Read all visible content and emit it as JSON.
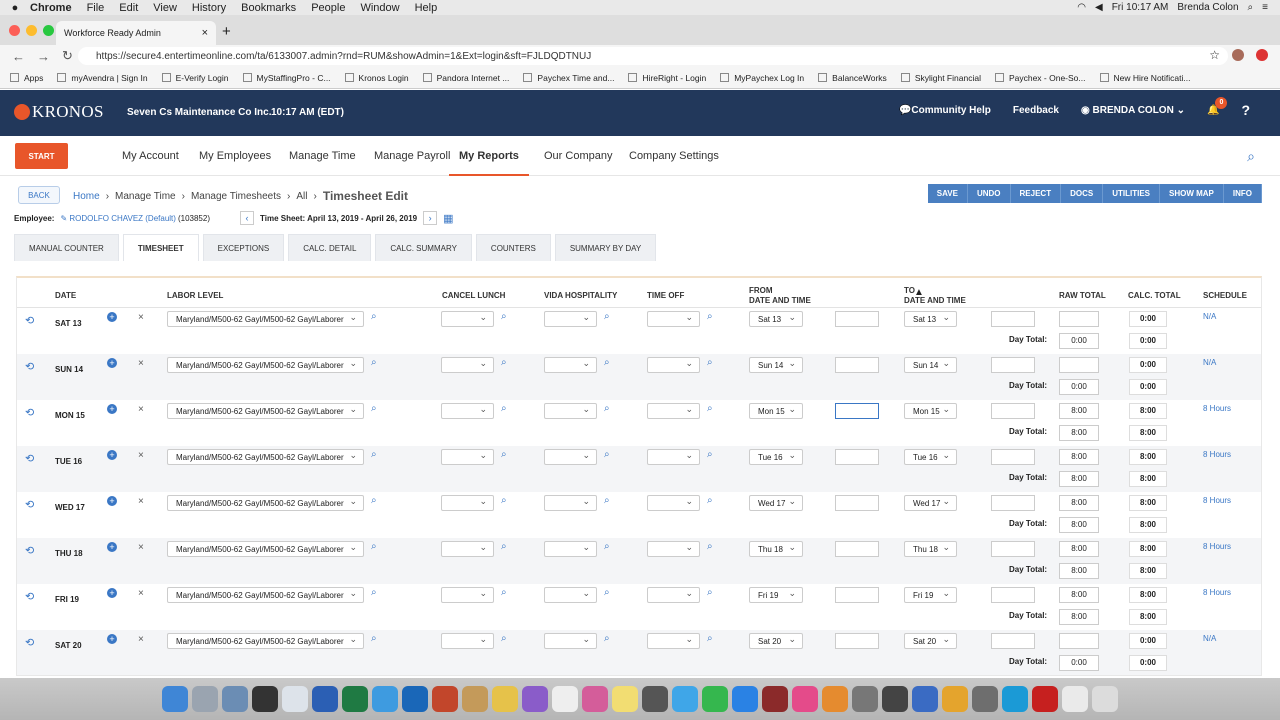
{
  "macmenu": {
    "app": "Chrome",
    "items": [
      "File",
      "Edit",
      "View",
      "History",
      "Bookmarks",
      "People",
      "Window",
      "Help"
    ],
    "clock": "Fri 10:17 AM",
    "user": "Brenda Colon"
  },
  "browser": {
    "tab_title": "Workforce Ready Admin",
    "url": "https://secure4.entertimeonline.com/ta/6133007.admin?rnd=RUM&showAdmin=1&Ext=login&sft=FJLDQDTNUJ",
    "bookmarks": [
      "Apps",
      "myAvendra | Sign In",
      "E-Verify Login",
      "MyStaffingPro - C...",
      "Kronos Login",
      "Pandora Internet ...",
      "Paychex Time and...",
      "HireRight - Login",
      "MyPaychex Log In",
      "BalanceWorks",
      "Skylight Financial",
      "Paychex - One-So...",
      "New Hire Notificati..."
    ]
  },
  "header": {
    "logo": "KRONOS",
    "company": "Seven Cs Maintenance Co Inc.",
    "time": "10:17 AM (EDT)",
    "help": "Community Help",
    "feedback": "Feedback",
    "user": "BRENDA COLON",
    "notif": "0"
  },
  "nav": {
    "start": "START",
    "items": [
      "My Account",
      "My Employees",
      "Manage Time",
      "Manage Payroll",
      "My Reports",
      "Our Company",
      "Company Settings"
    ],
    "active": "My Reports"
  },
  "crumbs": {
    "back": "BACK",
    "home": "Home",
    "c1": "Manage Time",
    "c2": "Manage Timesheets",
    "c3": "All",
    "current": "Timesheet Edit"
  },
  "actions": [
    "SAVE",
    "UNDO",
    "REJECT",
    "DOCS",
    "UTILITIES",
    "SHOW MAP",
    "INFO"
  ],
  "employee": {
    "label": "Employee:",
    "name": "RODOLFO CHAVEZ (Default)",
    "id": "(103852)",
    "ts_label": "Time Sheet: April 13, 2019 - April 26, 2019"
  },
  "tabs": [
    "MANUAL COUNTER",
    "TIMESHEET",
    "EXCEPTIONS",
    "CALC. DETAIL",
    "CALC. SUMMARY",
    "COUNTERS",
    "SUMMARY BY DAY"
  ],
  "active_tab": "TIMESHEET",
  "columns": {
    "date": "DATE",
    "labor": "LABOR LEVEL",
    "cancel": "CANCEL LUNCH",
    "vida": "VIDA HOSPITALITY",
    "timeoff": "TIME OFF",
    "from1": "FROM",
    "from2": "DATE AND TIME",
    "to1": "TO",
    "to2": "DATE AND TIME",
    "raw": "RAW TOTAL",
    "calc": "CALC. TOTAL",
    "schedule": "SCHEDULE"
  },
  "day_total_label": "Day Total:",
  "rows": [
    {
      "date": "SAT 13",
      "labor": "Maryland/M500-62 Gayl/M500-62 Gayl/Laborer",
      "from": "Sat 13",
      "to": "Sat 13",
      "raw": "",
      "calc": "0:00",
      "sched": "N/A",
      "dt_raw": "0:00",
      "dt_calc": "0:00"
    },
    {
      "date": "SUN 14",
      "labor": "Maryland/M500-62 Gayl/M500-62 Gayl/Laborer",
      "from": "Sun 14",
      "to": "Sun 14",
      "raw": "",
      "calc": "0:00",
      "sched": "N/A",
      "dt_raw": "0:00",
      "dt_calc": "0:00"
    },
    {
      "date": "MON 15",
      "labor": "Maryland/M500-62 Gayl/M500-62 Gayl/Laborer",
      "from": "Mon 15",
      "to": "Mon 15",
      "raw": "8:00",
      "calc": "8:00",
      "sched": "8 Hours",
      "dt_raw": "8:00",
      "dt_calc": "8:00"
    },
    {
      "date": "TUE 16",
      "labor": "Maryland/M500-62 Gayl/M500-62 Gayl/Laborer",
      "from": "Tue 16",
      "to": "Tue 16",
      "raw": "8:00",
      "calc": "8:00",
      "sched": "8 Hours",
      "dt_raw": "8:00",
      "dt_calc": "8:00"
    },
    {
      "date": "WED 17",
      "labor": "Maryland/M500-62 Gayl/M500-62 Gayl/Laborer",
      "from": "Wed 17",
      "to": "Wed 17",
      "raw": "8:00",
      "calc": "8:00",
      "sched": "8 Hours",
      "dt_raw": "8:00",
      "dt_calc": "8:00"
    },
    {
      "date": "THU 18",
      "labor": "Maryland/M500-62 Gayl/M500-62 Gayl/Laborer",
      "from": "Thu 18",
      "to": "Thu 18",
      "raw": "8:00",
      "calc": "8:00",
      "sched": "8 Hours",
      "dt_raw": "8:00",
      "dt_calc": "8:00"
    },
    {
      "date": "FRI 19",
      "labor": "Maryland/M500-62 Gayl/M500-62 Gayl/Laborer",
      "from": "Fri 19",
      "to": "Fri 19",
      "raw": "8:00",
      "calc": "8:00",
      "sched": "8 Hours",
      "dt_raw": "8:00",
      "dt_calc": "8:00"
    },
    {
      "date": "SAT 20",
      "labor": "Maryland/M500-62 Gayl/M500-62 Gayl/Laborer",
      "from": "Sat 20",
      "to": "Sat 20",
      "raw": "",
      "calc": "0:00",
      "sched": "N/A",
      "dt_raw": "0:00",
      "dt_calc": "0:00"
    }
  ],
  "colors": {
    "header": "#22385b",
    "accent": "#e8562a",
    "link": "#3a77c5"
  }
}
